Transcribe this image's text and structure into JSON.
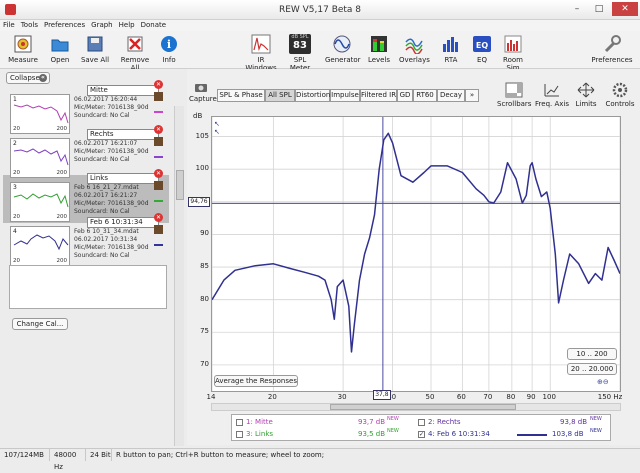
{
  "window": {
    "title": "REW V5,17 Beta 8",
    "minimize": "–",
    "maximize": "□",
    "close": "✕"
  },
  "menu": [
    "File",
    "Tools",
    "Preferences",
    "Graph",
    "Help",
    "Donate"
  ],
  "toolbar": {
    "measure": "Measure",
    "open": "Open",
    "save_all": "Save All",
    "remove_all": "Remove All",
    "info": "Info",
    "ir_windows": "IR Windows",
    "spl_meter": "SPL Meter",
    "spl_badge_top": "dB SPL",
    "spl_value": "83",
    "generator": "Generator",
    "levels": "Levels",
    "overlays": "Overlays",
    "rta": "RTA",
    "eq": "EQ",
    "room_sim": "Room Sim",
    "preferences": "Preferences"
  },
  "left": {
    "collapse": "Collapse",
    "measurements": [
      {
        "num": "1",
        "name": "Mitte",
        "date": "06.02.2017 16:20:44",
        "mic": "Mic/Meter: 7016138_90d",
        "sc": "Soundcard: No Cal",
        "x0": "20",
        "x1": "200"
      },
      {
        "num": "2",
        "name": "Rechts",
        "date": "06.02.2017 16:21:07",
        "mic": "Mic/Meter: 7016138_90d",
        "sc": "Soundcard: No Cal",
        "x0": "20",
        "x1": "200"
      },
      {
        "num": "3",
        "name": "Links",
        "file": "Feb 6 16_21_27.mdat",
        "date": "06.02.2017 16:21:27",
        "mic": "Mic/Meter: 7016138_90d",
        "sc": "Soundcard: No Cal",
        "x0": "20",
        "x1": "200"
      },
      {
        "num": "4",
        "name": "Feb 6 10:31:34",
        "file": "Feb 6 10_31_34.mdat",
        "date": "06.02.2017 10:31:34",
        "mic": "Mic/Meter: 7016138_90d",
        "sc": "Soundcard: No Cal",
        "x0": "20",
        "x1": "200"
      }
    ],
    "change_cal": "Change Cal..."
  },
  "graph": {
    "capture": "Capture",
    "tabs": [
      "SPL & Phase",
      "All SPL",
      "Distortion",
      "Impulse",
      "Filtered IR",
      "GD",
      "RT60",
      "Decay",
      "»"
    ],
    "active_tab": "All SPL",
    "tools": {
      "scrollbars": "Scrollbars",
      "freq_axis": "Freq. Axis",
      "limits": "Limits",
      "controls": "Controls"
    },
    "ylabel": "dB",
    "cursor_value": "94,76",
    "cursor_freq": "37,8",
    "range_10_200": "10 .. 200",
    "range_20_20000": "20 .. 20.000",
    "average_button": "Average the Responses",
    "xunit": "150 Hz"
  },
  "legend": [
    {
      "label": "1: Mitte",
      "value": "93,7 dB",
      "tag": "NEW",
      "color": "#b040b0",
      "checked": false
    },
    {
      "label": "2: Rechts",
      "value": "93,8 dB",
      "tag": "NEW",
      "color": "#8040c0",
      "checked": false
    },
    {
      "label": "3: Links",
      "value": "93,5 dB",
      "tag": "NEW",
      "color": "#30a030",
      "checked": false
    },
    {
      "label": "4: Feb 6 10:31:34",
      "value": "103,8 dB",
      "tag": "NEW",
      "color": "#303090",
      "checked": true
    }
  ],
  "status": {
    "mem": "107/124MB",
    "rate": "48000 Hz",
    "bits": "24 Bit",
    "hint": "R button to pan; Ctrl+R button to measure; wheel to zoom;"
  },
  "chart_data": {
    "type": "line",
    "xlabel": "",
    "ylabel": "dB",
    "xscale": "log",
    "xlim": [
      14,
      150
    ],
    "ylim": [
      66,
      108
    ],
    "xticks": [
      14,
      20,
      30,
      40,
      50,
      60,
      70,
      80,
      90,
      100,
      150
    ],
    "xtick_labels": [
      "14",
      "20",
      "30",
      "40",
      "50",
      "60",
      "70",
      "80",
      "90",
      "100",
      "150 Hz"
    ],
    "yticks": [
      70,
      75,
      80,
      85,
      90,
      95,
      100,
      105
    ],
    "cursor": {
      "x": 37.8,
      "y": 94.76
    },
    "series": [
      {
        "name": "4: Feb 6 10:31:34",
        "color": "#303090",
        "x": [
          14,
          15,
          16,
          18,
          20,
          22,
          24,
          26,
          27,
          28,
          28.5,
          29,
          30,
          31,
          31.5,
          32,
          33,
          34,
          35,
          36,
          37,
          38,
          39,
          40,
          42,
          45,
          48,
          50,
          55,
          60,
          65,
          68,
          70,
          72,
          75,
          78,
          82,
          85,
          87,
          89,
          90,
          92,
          95,
          98,
          100,
          103,
          105,
          108,
          112,
          118,
          125,
          130,
          135,
          140,
          145,
          150
        ],
        "y": [
          80,
          83,
          84.5,
          85.2,
          85.5,
          84.8,
          84.2,
          83.6,
          83,
          80,
          77,
          82,
          83,
          79,
          72,
          76,
          83,
          87,
          89.5,
          93,
          100,
          104.5,
          105.5,
          104,
          99,
          98,
          99.5,
          100.5,
          100.5,
          99.5,
          97,
          96,
          95,
          94.8,
          96.5,
          101,
          98.5,
          94.8,
          96,
          100.5,
          101,
          98.5,
          95.8,
          96.5,
          94,
          87,
          79.5,
          83,
          87,
          85.5,
          82.5,
          84,
          83,
          88,
          86,
          84
        ]
      }
    ]
  }
}
